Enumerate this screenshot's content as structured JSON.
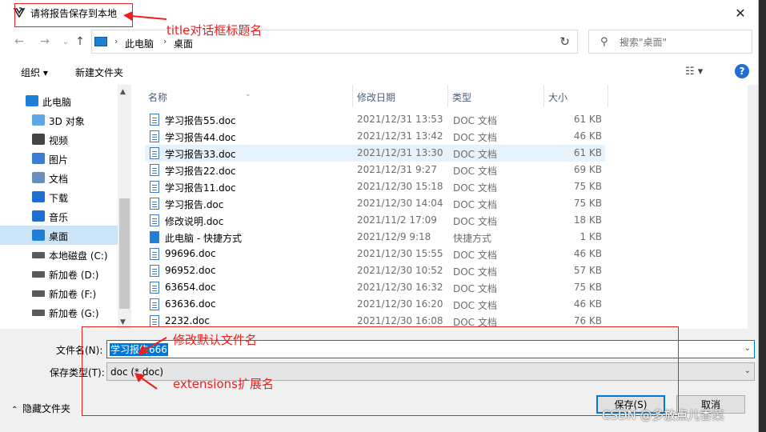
{
  "window": {
    "title": "请将报告保存到本地",
    "close_glyph": "✕"
  },
  "nav": {
    "back_glyph": "←",
    "forward_glyph": "→",
    "recent_glyph": "⌄",
    "up_glyph": "↑",
    "breadcrumb": [
      "此电脑",
      "桌面"
    ],
    "crumb_sep": "›",
    "dropdown_glyph": "⌄",
    "refresh_glyph": "↻",
    "search_placeholder": "搜索\"桌面\"",
    "search_glyph": "⚲"
  },
  "toolbar": {
    "organize_label": "组织 ▾",
    "new_folder_label": "新建文件夹",
    "view_glyph": "☷ ▾",
    "help_glyph": "?"
  },
  "sidebar": {
    "items": [
      {
        "label": "此电脑",
        "icon": "computer-icon",
        "color": "#1e7fd6"
      },
      {
        "label": "3D 对象",
        "icon": "cube-3d-icon",
        "color": "#5fa8e8"
      },
      {
        "label": "视频",
        "icon": "film-icon",
        "color": "#444444"
      },
      {
        "label": "图片",
        "icon": "picture-icon",
        "color": "#3a7bd5"
      },
      {
        "label": "文档",
        "icon": "document-icon",
        "color": "#6a8fbf"
      },
      {
        "label": "下载",
        "icon": "download-arrow-icon",
        "color": "#1e6fd0"
      },
      {
        "label": "音乐",
        "icon": "music-note-icon",
        "color": "#1e6fd0"
      },
      {
        "label": "桌面",
        "icon": "desktop-icon",
        "color": "#1e7fd6"
      },
      {
        "label": "本地磁盘 (C:)",
        "icon": "drive-c-icon",
        "color": "#5a5a5a"
      },
      {
        "label": "新加卷 (D:)",
        "icon": "drive-icon",
        "color": "#5a5a5a"
      },
      {
        "label": "新加卷 (F:)",
        "icon": "drive-icon",
        "color": "#5a5a5a"
      },
      {
        "label": "新加卷 (G:)",
        "icon": "drive-icon",
        "color": "#5a5a5a"
      }
    ],
    "selected_index": 7
  },
  "columns": {
    "name": "名称",
    "date": "修改日期",
    "type": "类型",
    "size": "大小"
  },
  "files": [
    {
      "name": "学习报告55.doc",
      "date": "2021/12/31 13:53",
      "type": "DOC 文档",
      "size": "61 KB"
    },
    {
      "name": "学习报告44.doc",
      "date": "2021/12/31 13:42",
      "type": "DOC 文档",
      "size": "46 KB"
    },
    {
      "name": "学习报告33.doc",
      "date": "2021/12/31 13:30",
      "type": "DOC 文档",
      "size": "61 KB"
    },
    {
      "name": "学习报告22.doc",
      "date": "2021/12/31 9:27",
      "type": "DOC 文档",
      "size": "69 KB"
    },
    {
      "name": "学习报告11.doc",
      "date": "2021/12/30 15:18",
      "type": "DOC 文档",
      "size": "75 KB"
    },
    {
      "name": "学习报告.doc",
      "date": "2021/12/30 14:04",
      "type": "DOC 文档",
      "size": "75 KB"
    },
    {
      "name": "修改说明.doc",
      "date": "2021/11/2 17:09",
      "type": "DOC 文档",
      "size": "18 KB"
    },
    {
      "name": "此电脑 - 快捷方式",
      "date": "2021/12/9 9:18",
      "type": "快捷方式",
      "size": "1 KB"
    },
    {
      "name": "99696.doc",
      "date": "2021/12/30 15:55",
      "type": "DOC 文档",
      "size": "46 KB"
    },
    {
      "name": "96952.doc",
      "date": "2021/12/30 10:52",
      "type": "DOC 文档",
      "size": "57 KB"
    },
    {
      "name": "63654.doc",
      "date": "2021/12/30 16:32",
      "type": "DOC 文档",
      "size": "75 KB"
    },
    {
      "name": "63636.doc",
      "date": "2021/12/30 16:20",
      "type": "DOC 文档",
      "size": "46 KB"
    },
    {
      "name": "2232.doc",
      "date": "2021/12/30 16:08",
      "type": "DOC 文档",
      "size": "76 KB"
    }
  ],
  "hovered_file_index": 2,
  "form": {
    "filename_label": "文件名(N):",
    "filename_value": "学习报告666",
    "filetype_label": "保存类型(T):",
    "filetype_value": "doc (*.doc)",
    "hide_folders_label": "隐藏文件夹",
    "hide_folders_glyph": "⌃",
    "save_label": "保存(S)",
    "cancel_label": "取消"
  },
  "annotations": {
    "title_note": "title对话框标题名",
    "filename_note": "修改默认文件名",
    "extensions_note": "extensions扩展名",
    "color": "#e82020"
  },
  "watermark": "CSDN @多放点儿香菜"
}
